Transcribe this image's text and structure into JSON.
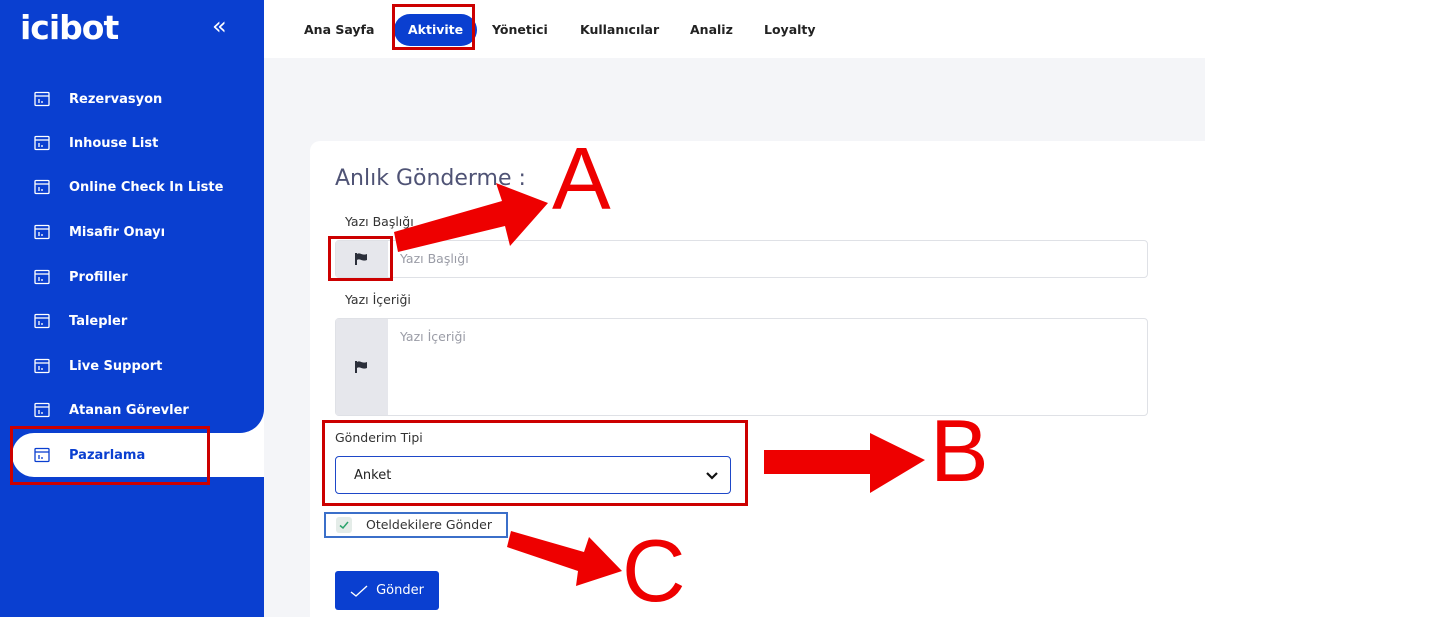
{
  "app": {
    "logo": "icibot",
    "collapse_glyph": "«"
  },
  "sidebar": {
    "items": [
      {
        "label": "Rezervasyon",
        "icon": "calendar-icon"
      },
      {
        "label": "Inhouse List",
        "icon": "calendar-icon"
      },
      {
        "label": "Online Check In Liste",
        "icon": "calendar-icon"
      },
      {
        "label": "Misafir Onayı",
        "icon": "calendar-icon"
      },
      {
        "label": "Profiller",
        "icon": "calendar-icon"
      },
      {
        "label": "Talepler",
        "icon": "calendar-icon"
      },
      {
        "label": "Live Support",
        "icon": "calendar-icon"
      },
      {
        "label": "Atanan Görevler",
        "icon": "calendar-icon"
      },
      {
        "label": "Pazarlama",
        "icon": "calendar-icon",
        "active": true
      }
    ]
  },
  "topnav": {
    "tabs": [
      {
        "label": "Ana Sayfa"
      },
      {
        "label": "Aktivite",
        "active": true
      },
      {
        "label": "Yönetici"
      },
      {
        "label": "Kullanıcılar"
      },
      {
        "label": "Analiz"
      },
      {
        "label": "Loyalty"
      }
    ]
  },
  "form": {
    "title": "Anlık Gönderme :",
    "title_label": "Yazı Başlığı",
    "title_placeholder": "Yazı Başlığı",
    "content_label": "Yazı İçeriği",
    "content_placeholder": "Yazı İçeriği",
    "send_type_label": "Gönderim Tipi",
    "send_type_value": "Anket",
    "checkbox_label": "Oteldekilere Gönder",
    "checkbox_checked": true,
    "submit_label": "Gönder"
  },
  "annotations": {
    "a": "A",
    "b": "B",
    "c": "C"
  },
  "colors": {
    "brand": "#0a3fd0",
    "highlight": "#cc0000",
    "arrow": "#ee0000"
  }
}
